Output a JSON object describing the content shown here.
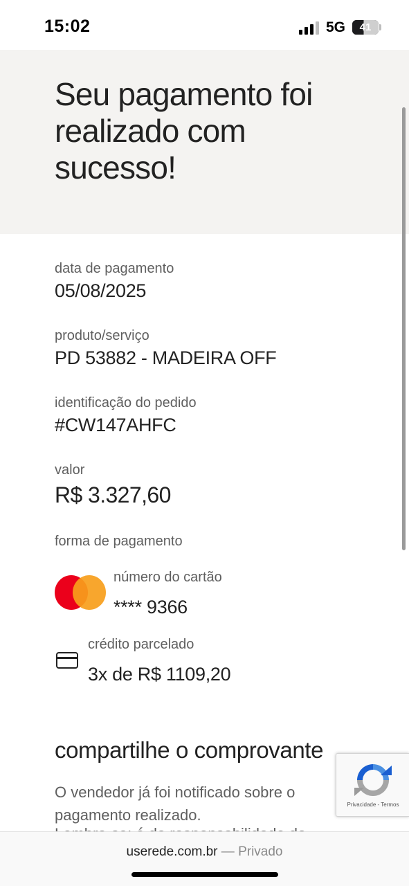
{
  "status_bar": {
    "time": "15:02",
    "network": "5G",
    "battery": "41"
  },
  "hero": {
    "title": "Seu pagamento foi realizado com sucesso!"
  },
  "details": {
    "payment_date_label": "data de pagamento",
    "payment_date": "05/08/2025",
    "product_label": "produto/serviço",
    "product": "PD 53882 - MADEIRA OFF",
    "order_id_label": "identificação do pedido",
    "order_id": "#CW147AHFC",
    "amount_label": "valor",
    "amount": "R$ 3.327,60",
    "payment_method_label": "forma de pagamento",
    "card_number_label": "número do cartão",
    "card_number": "**** 9366",
    "installment_label": "crédito parcelado",
    "installments": "3x de R$ 1109,20"
  },
  "share": {
    "title": "compartilhe o comprovante",
    "text": "O vendedor já foi notificado sobre o pagamento realizado.",
    "text_cut": "Lembre-se: é de responsabilidade do"
  },
  "recaptcha": {
    "links": "Privacidade - Termos"
  },
  "address_bar": {
    "domain": "userede.com.br",
    "mode": "— Privado"
  },
  "colors": {
    "hero_bg": "#f4f3f1",
    "mastercard_red": "#eb001b",
    "mastercard_orange": "#f79e1b"
  }
}
